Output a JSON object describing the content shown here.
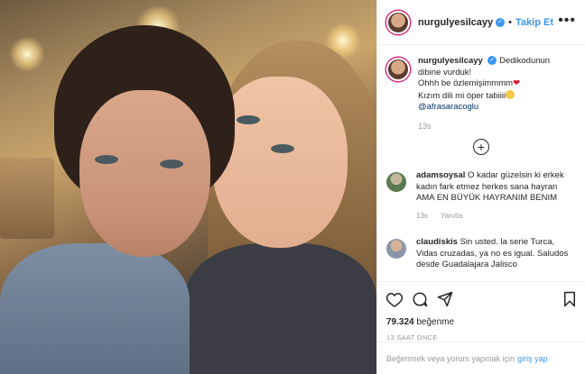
{
  "post": {
    "username": "nurgulyesilcayy",
    "follow_label": "Takip Et",
    "more_label": "•••",
    "dot": "•"
  },
  "caption": {
    "username": "nurgulyesilcayy",
    "line1": "Dedikodunun",
    "line2": "dibine vurduk!",
    "line3": "Ohhh be özlemişimmmm",
    "heart": "❤",
    "line4": "Kızım dili mi öper tabiiii",
    "mention": "@afrasaracoglu",
    "time": "13s",
    "load_more": "+"
  },
  "comments": [
    {
      "username": "adamsoysal",
      "text": "O kadar güzelsin ki erkek kadın fark etmez herkes sana hayran AMA EN BÜYÜK HAYRANIM BENIM",
      "time": "13s",
      "reply_label": "Yanıtla"
    },
    {
      "username": "claudiskis",
      "text": "Sin usted. la serie Turca, Vidas cruzadas, ya no es igual. Saludos desde Guadalajara Jalisco"
    }
  ],
  "stats": {
    "likes_count": "79.324",
    "likes_label": "beğenme",
    "post_time": "13 SAAT ÖNCE"
  },
  "login": {
    "prompt": "Beğenmek veya yorum yapmak için",
    "link": "giriş yap"
  },
  "colors": {
    "link": "#3897f0",
    "heart": "#e0172b"
  }
}
